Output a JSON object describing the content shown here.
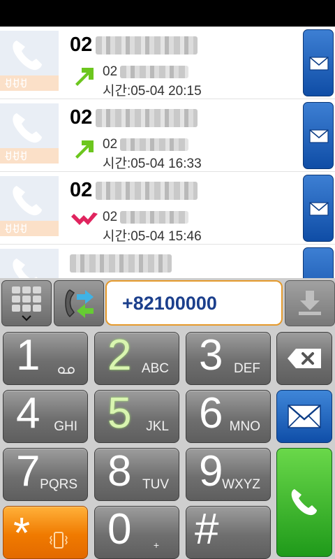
{
  "calllog": {
    "entries": [
      {
        "number_prefix": "02",
        "sub_prefix": "02",
        "time": "시간:05-04 20:15",
        "direction": "outgoing"
      },
      {
        "number_prefix": "02",
        "sub_prefix": "02",
        "time": "시간:05-04 16:33",
        "direction": "outgoing"
      },
      {
        "number_prefix": "02",
        "sub_prefix": "02",
        "time": "시간:05-04 15:46",
        "direction": "missed"
      }
    ]
  },
  "dialer": {
    "number_value": "+82100000"
  },
  "keys": {
    "k1": {
      "digit": "1",
      "icon": "voicemail-icon"
    },
    "k2": {
      "digit": "2",
      "letters": "ABC"
    },
    "k3": {
      "digit": "3",
      "letters": "DEF"
    },
    "k4": {
      "digit": "4",
      "letters": "GHI"
    },
    "k5": {
      "digit": "5",
      "letters": "JKL"
    },
    "k6": {
      "digit": "6",
      "letters": "MNO"
    },
    "k7": {
      "digit": "7",
      "letters": "PQRS"
    },
    "k8": {
      "digit": "8",
      "letters": "TUV"
    },
    "k9": {
      "digit": "9",
      "letters": "WXYZ"
    },
    "kstar": {
      "digit": "*",
      "icon": "vibrate-icon"
    },
    "k0": {
      "digit": "0",
      "letters": "+"
    },
    "khash": {
      "digit": "#"
    }
  },
  "colors": {
    "accent_orange": "#f07a00",
    "message_blue": "#0f4da6",
    "call_green": "#1f9a1a",
    "outgoing_arrow": "#6cc61e",
    "missed_arrow": "#e0245e",
    "number_text": "#1b3f8c"
  },
  "icons": {
    "dialpad": "dialpad-icon",
    "swap": "call-swap-icon",
    "save": "save-download-icon",
    "backspace": "backspace-icon",
    "message": "envelope-icon",
    "call": "phone-handset-icon"
  }
}
